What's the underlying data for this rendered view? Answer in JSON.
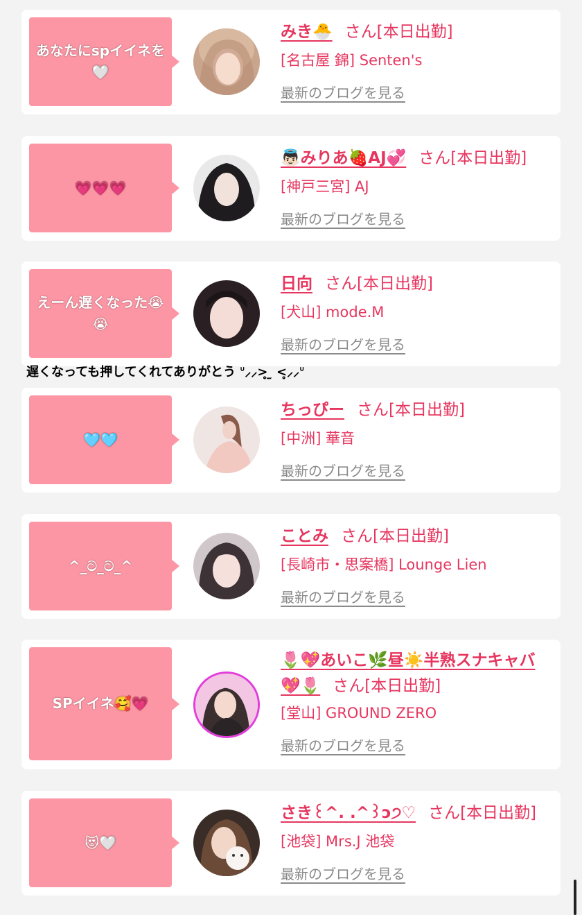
{
  "cards": [
    {
      "message": "あなたにspイイネを🤍",
      "name": "みき🐣",
      "suffix": "さん[本日出勤]",
      "shop": "[名古屋 錦] Senten's",
      "blog_link": "最新のブログを見る"
    },
    {
      "message": "💗💗💗",
      "name": "👼🏻みりあ🍓AJ💞",
      "suffix": "さん[本日出勤]",
      "shop": "[神戸三宮] AJ",
      "blog_link": "最新のブログを見る"
    },
    {
      "message": "えーん遅くなった😭😭",
      "name": "日向",
      "suffix": "さん[本日出勤]",
      "shop": "[犬山] mode.M",
      "blog_link": "最新のブログを見る",
      "comment": "遅くなっても押してくれてありがとう ᐡ⸝⸝>̥̥ ̫ <̥̥⸝⸝ᐡ"
    },
    {
      "message": "🩵🩵",
      "name": "ちっぴー",
      "suffix": "さん[本日出勤]",
      "shop": "[中洲] 華音",
      "blog_link": "最新のブログを見る"
    },
    {
      "message": "^_ට_ට_^",
      "name": "ことみ",
      "suffix": "さん[本日出勤]",
      "shop": "[長崎市・思案橋] Lounge Lien",
      "blog_link": "最新のブログを見る"
    },
    {
      "message": "SPイイネ🥰💗",
      "name": "🌷💖あいこ🌿昼☀️半熟スナキャバ💖🌷",
      "suffix": "さん[本日出勤]",
      "shop": "[堂山] GROUND ZERO",
      "blog_link": "最新のブログを見る"
    },
    {
      "message": "😻🤍",
      "name": "さき꒰^. .^꒱ɔ੭♡",
      "suffix": "さん[本日出勤]",
      "shop": "[池袋] Mrs.J 池袋",
      "blog_link": "最新のブログを見る"
    }
  ],
  "colors": {
    "accent": "#e6365f",
    "bubble": "#fd96a4",
    "link_gray": "#8a8a8a",
    "background": "#f3f3f4"
  }
}
